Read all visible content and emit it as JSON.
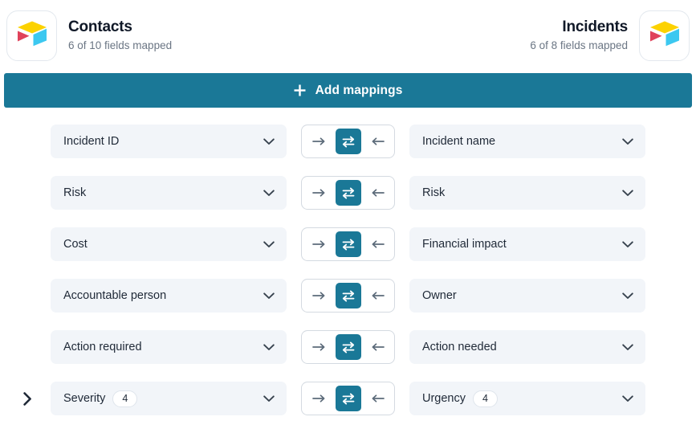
{
  "header": {
    "left": {
      "logo_icon": "airtable-logo-icon",
      "title": "Contacts",
      "subtitle": "6 of 10 fields mapped"
    },
    "right": {
      "logo_icon": "airtable-logo-icon",
      "title": "Incidents",
      "subtitle": "6 of 8 fields mapped"
    }
  },
  "add_mappings": {
    "plus_icon": "plus-icon",
    "label": "Add mappings"
  },
  "direction": {
    "forward_icon": "arrow-right-icon",
    "bidirectional_icon": "arrows-bidirectional-icon",
    "backward_icon": "arrow-left-icon",
    "selected": "bidirectional"
  },
  "colors": {
    "accent": "#1a7897",
    "field_bg": "#f2f5f9",
    "text": "#1f2937",
    "muted_text": "#6b7684",
    "border": "#d4dae1"
  },
  "rows": [
    {
      "expandable": false,
      "left_field": "Incident ID",
      "left_badge": null,
      "direction": "bidirectional",
      "right_field": "Incident name",
      "right_badge": null
    },
    {
      "expandable": false,
      "left_field": "Risk",
      "left_badge": null,
      "direction": "bidirectional",
      "right_field": "Risk",
      "right_badge": null
    },
    {
      "expandable": false,
      "left_field": "Cost",
      "left_badge": null,
      "direction": "bidirectional",
      "right_field": "Financial impact",
      "right_badge": null
    },
    {
      "expandable": false,
      "left_field": "Accountable person",
      "left_badge": null,
      "direction": "bidirectional",
      "right_field": "Owner",
      "right_badge": null
    },
    {
      "expandable": false,
      "left_field": "Action required",
      "left_badge": null,
      "direction": "bidirectional",
      "right_field": "Action needed",
      "right_badge": null
    },
    {
      "expandable": true,
      "expand_icon": "chevron-right-icon",
      "left_field": "Severity",
      "left_badge": "4",
      "direction": "bidirectional",
      "right_field": "Urgency",
      "right_badge": "4"
    }
  ]
}
